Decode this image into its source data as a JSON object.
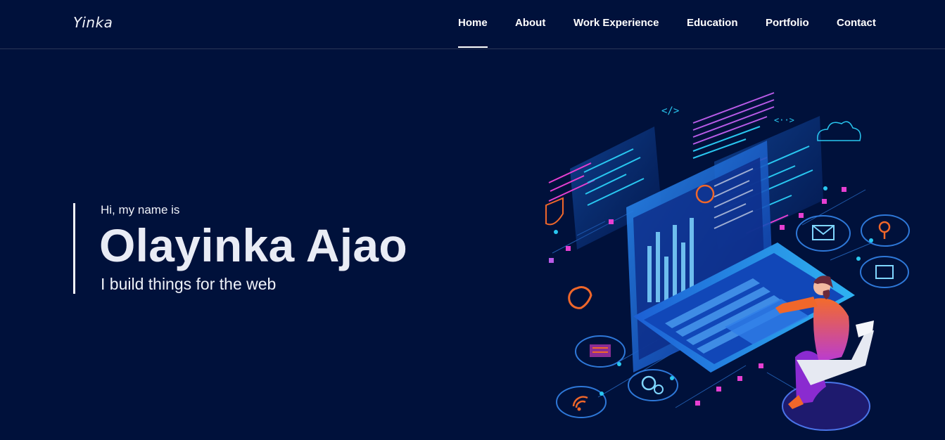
{
  "brand": {
    "name": "Yinka"
  },
  "nav": {
    "items": [
      {
        "label": "Home",
        "active": true
      },
      {
        "label": "About",
        "active": false
      },
      {
        "label": "Work Experience",
        "active": false
      },
      {
        "label": "Education",
        "active": false
      },
      {
        "label": "Portfolio",
        "active": false
      },
      {
        "label": "Contact",
        "active": false
      }
    ]
  },
  "hero": {
    "greeting": "Hi, my name is",
    "name": "Olayinka Ajao",
    "tagline": "I build things for the web"
  },
  "colors": {
    "background": "#00113b",
    "text": "#ffffff",
    "accent_cyan": "#29c7f0",
    "accent_pink": "#e63fd1",
    "accent_orange": "#f0672a"
  }
}
